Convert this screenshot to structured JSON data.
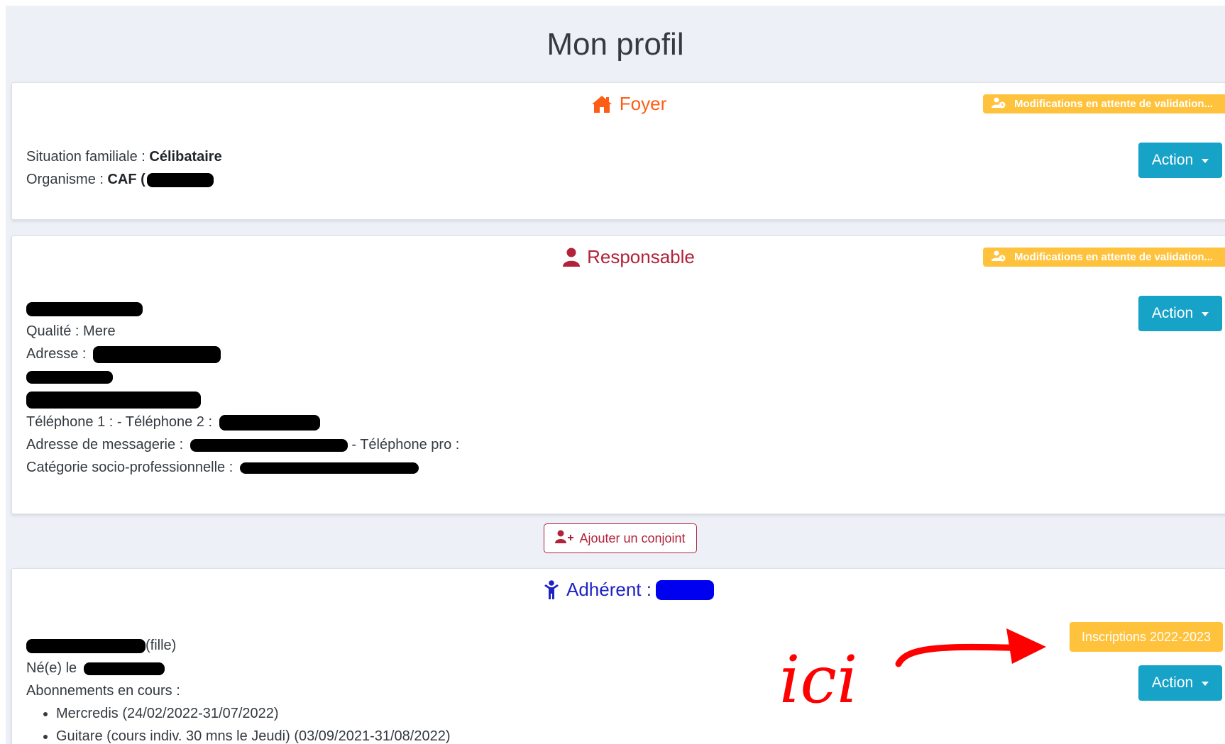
{
  "page_title": "Mon profil",
  "foyer": {
    "title": "Foyer",
    "badge": "Modifications en attente de validation...",
    "action": "Action",
    "situation_label": "Situation familiale : ",
    "situation_value": "Célibataire",
    "organisme_label": "Organisme : ",
    "organisme_value": "CAF ("
  },
  "responsable": {
    "title": "Responsable",
    "badge": "Modifications en attente de validation...",
    "action": "Action",
    "qualite": "Qualité : Mere",
    "adresse_label": "Adresse :",
    "telephone": "Téléphone 1 : - Téléphone 2 :",
    "messagerie_label": "Adresse de messagerie :",
    "telephone_pro": " - Téléphone pro :",
    "categorie_label": "Catégorie socio-professionnelle :"
  },
  "add_spouse": "Ajouter un conjoint",
  "adherent": {
    "title": "Adhérent :",
    "inscriptions": "Inscriptions 2022-2023",
    "action": "Action",
    "relation": "(fille)",
    "birth_label": "Né(e) le",
    "subscriptions_label": "Abonnements en cours :",
    "subscriptions": [
      "Mercredis (24/02/2022-31/07/2022)",
      "Guitare (cours indiv. 30 mns le Jeudi) (03/09/2021-31/08/2022)"
    ]
  },
  "annotation": "ici",
  "colors": {
    "foyer": "#fd5e16",
    "responsable": "#b1233a",
    "adherent": "#1e22c5",
    "badge": "#ffc23c",
    "action": "#17a2c8",
    "annotation": "#ff0000"
  }
}
